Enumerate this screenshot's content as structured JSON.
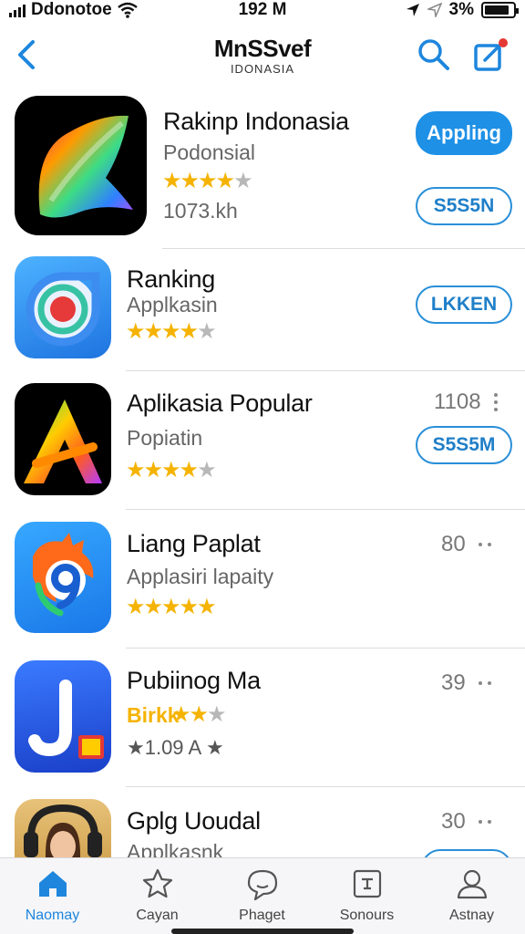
{
  "status_bar": {
    "carrier": "Ddonotoe",
    "time": "192 M",
    "battery": "3%"
  },
  "nav": {
    "title": "MnSSvef",
    "subtitle": "IDONASIA"
  },
  "apps": [
    {
      "name": "Rakinp Indonasia",
      "subtitle": "Podonsial",
      "rating_stars": 4,
      "meta_text": "1073.kh",
      "primary_button": "Appling",
      "secondary_button": "S5S5N"
    },
    {
      "name": "Ranking",
      "subtitle": "Applkasin",
      "rating_stars": 4,
      "secondary_button": "LKKEN"
    },
    {
      "name": "Aplikasia Popular",
      "subtitle": "Popiatin",
      "rating_stars": 4,
      "count": "1108",
      "secondary_button": "S5S5M"
    },
    {
      "name": "Liang Paplat",
      "subtitle": "Applasiri lapaity",
      "rating_stars": 5,
      "count": "80"
    },
    {
      "name": "Pubiinog Ma",
      "subtitle": "Birkk",
      "rating_stars": 3,
      "meta_text": "★1.09 A ★",
      "count": "39"
    },
    {
      "name": "Gplg Uoudal",
      "subtitle": "Applkasnk",
      "count": "30"
    }
  ],
  "tabbar": {
    "tabs": [
      {
        "label": "Naomay",
        "icon": "home-icon",
        "active": true
      },
      {
        "label": "Cayan",
        "icon": "star-icon",
        "active": false
      },
      {
        "label": "Phaget",
        "icon": "chat-icon",
        "active": false
      },
      {
        "label": "Sonours",
        "icon": "list-icon",
        "active": false
      },
      {
        "label": "Astnay",
        "icon": "person-icon",
        "active": false
      }
    ]
  },
  "colors": {
    "accent": "#1e90e6",
    "star": "#f5b301",
    "badge": "#e53935"
  }
}
